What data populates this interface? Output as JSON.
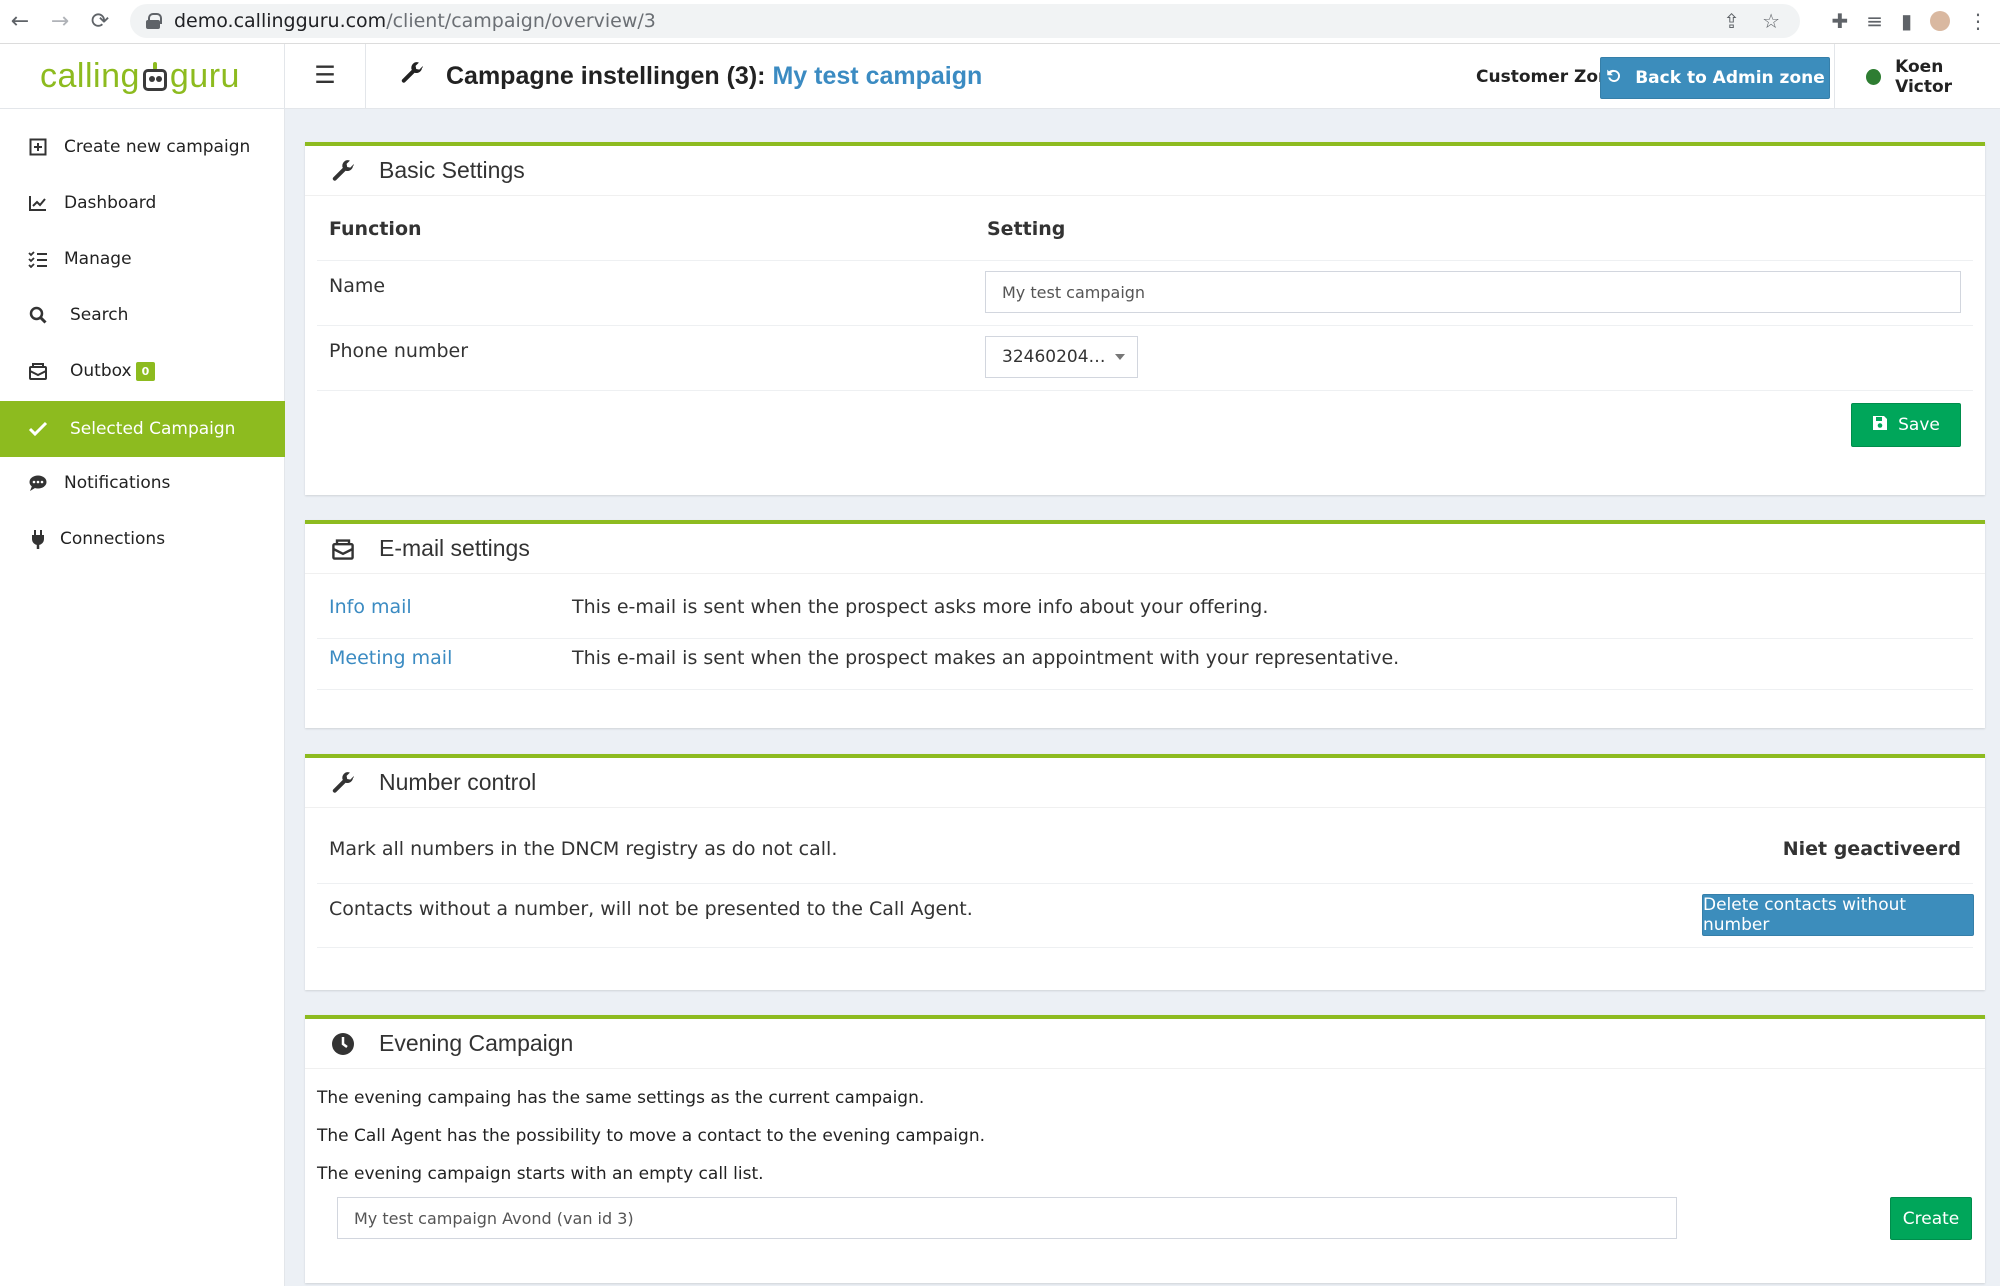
{
  "browser": {
    "url_host": "demo.callingguru.com",
    "url_path": "/client/campaign/overview/3"
  },
  "header": {
    "logo_left": "calling",
    "logo_right": "guru",
    "title_prefix": "Campagne instellingen (3):",
    "title_campaign": "My test campaign",
    "customer_zone": "Customer Zone",
    "admin_button": "Back to Admin zone",
    "user_name": "Koen Victor"
  },
  "sidebar": {
    "items": [
      {
        "label": "Create new campaign"
      },
      {
        "label": "Dashboard"
      },
      {
        "label": "Manage"
      },
      {
        "label": "Search"
      },
      {
        "label": "Outbox",
        "badge": "0"
      },
      {
        "label": "Selected Campaign"
      },
      {
        "label": "Notifications"
      },
      {
        "label": "Connections"
      }
    ]
  },
  "basic_settings": {
    "title": "Basic Settings",
    "col_function": "Function",
    "col_setting": "Setting",
    "name_label": "Name",
    "name_value": "My test campaign",
    "phone_label": "Phone number",
    "phone_value": "32460204…",
    "save_label": "Save"
  },
  "email_settings": {
    "title": "E-mail settings",
    "rows": [
      {
        "link": "Info mail",
        "description": "This e-mail is sent when the prospect asks more info about your offering."
      },
      {
        "link": "Meeting mail",
        "description": "This e-mail is sent when the prospect makes an appointment with your representative."
      }
    ]
  },
  "number_control": {
    "title": "Number control",
    "dncm_text": "Mark all numbers in the DNCM registry as do not call.",
    "dncm_status": "Niet geactiveerd",
    "contacts_text": "Contacts without a number, will not be presented to the Call Agent.",
    "delete_button": "Delete contacts without number"
  },
  "evening_campaign": {
    "title": "Evening Campaign",
    "lines": [
      "The evening campaing has the same settings as the current campaign.",
      "The Call Agent has the possibility to move a contact to the evening campaign.",
      "The evening campaign starts with an empty call list."
    ],
    "input_value": "My test campaign Avond (van id 3)",
    "create_button": "Create"
  },
  "colors": {
    "brand_green": "#8dbb1f",
    "link_blue": "#3b8bc2",
    "button_blue": "#3c8dbc",
    "button_green": "#00a65a"
  }
}
